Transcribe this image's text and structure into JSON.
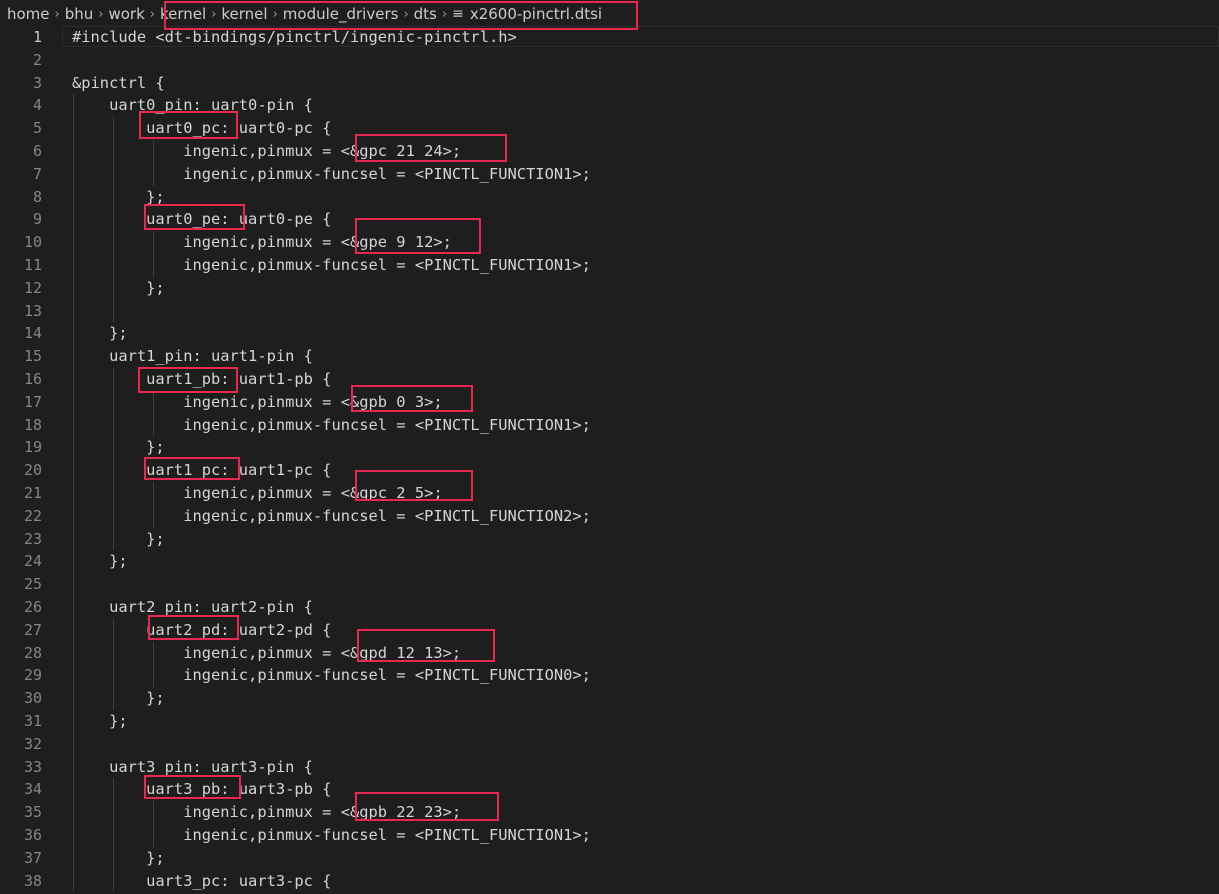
{
  "breadcrumb": {
    "items": [
      "home",
      "bhu",
      "work",
      "kernel",
      "kernel",
      "module_drivers",
      "dts"
    ],
    "file_name": "x2600-pinctrl.dtsi",
    "file_icon": "lines-file-icon"
  },
  "editor": {
    "lines": [
      {
        "number": "1",
        "text": "#include <dt-bindings/pinctrl/ingenic-pinctrl.h>"
      },
      {
        "number": "2",
        "text": ""
      },
      {
        "number": "3",
        "text": "&pinctrl {"
      },
      {
        "number": "4",
        "text": "    uart0_pin: uart0-pin {"
      },
      {
        "number": "5",
        "text": "        uart0_pc: uart0-pc {"
      },
      {
        "number": "6",
        "text": "            ingenic,pinmux = <&gpc 21 24>;"
      },
      {
        "number": "7",
        "text": "            ingenic,pinmux-funcsel = <PINCTL_FUNCTION1>;"
      },
      {
        "number": "8",
        "text": "        };"
      },
      {
        "number": "9",
        "text": "        uart0_pe: uart0-pe {"
      },
      {
        "number": "10",
        "text": "            ingenic,pinmux = <&gpe 9 12>;"
      },
      {
        "number": "11",
        "text": "            ingenic,pinmux-funcsel = <PINCTL_FUNCTION1>;"
      },
      {
        "number": "12",
        "text": "        };"
      },
      {
        "number": "13",
        "text": ""
      },
      {
        "number": "14",
        "text": "    };"
      },
      {
        "number": "15",
        "text": "    uart1_pin: uart1-pin {"
      },
      {
        "number": "16",
        "text": "        uart1_pb: uart1-pb {"
      },
      {
        "number": "17",
        "text": "            ingenic,pinmux = <&gpb 0 3>;"
      },
      {
        "number": "18",
        "text": "            ingenic,pinmux-funcsel = <PINCTL_FUNCTION1>;"
      },
      {
        "number": "19",
        "text": "        };"
      },
      {
        "number": "20",
        "text": "        uart1_pc: uart1-pc {"
      },
      {
        "number": "21",
        "text": "            ingenic,pinmux = <&gpc 2 5>;"
      },
      {
        "number": "22",
        "text": "            ingenic,pinmux-funcsel = <PINCTL_FUNCTION2>;"
      },
      {
        "number": "23",
        "text": "        };"
      },
      {
        "number": "24",
        "text": "    };"
      },
      {
        "number": "25",
        "text": ""
      },
      {
        "number": "26",
        "text": "    uart2_pin: uart2-pin {"
      },
      {
        "number": "27",
        "text": "        uart2_pd: uart2-pd {"
      },
      {
        "number": "28",
        "text": "            ingenic,pinmux = <&gpd 12 13>;"
      },
      {
        "number": "29",
        "text": "            ingenic,pinmux-funcsel = <PINCTL_FUNCTION0>;"
      },
      {
        "number": "30",
        "text": "        };"
      },
      {
        "number": "31",
        "text": "    };"
      },
      {
        "number": "32",
        "text": ""
      },
      {
        "number": "33",
        "text": "    uart3_pin: uart3-pin {"
      },
      {
        "number": "34",
        "text": "        uart3_pb: uart3-pb {"
      },
      {
        "number": "35",
        "text": "            ingenic,pinmux = <&gpb 22 23>;"
      },
      {
        "number": "36",
        "text": "            ingenic,pinmux-funcsel = <PINCTL_FUNCTION1>;"
      },
      {
        "number": "37",
        "text": "        };"
      },
      {
        "number": "38",
        "text": "        uart3_pc: uart3-pc {"
      }
    ]
  },
  "colors": {
    "background": "#1e1e1e",
    "text": "#d4d4d4",
    "line_number": "#858585",
    "annotation_box": "#e8284e"
  }
}
